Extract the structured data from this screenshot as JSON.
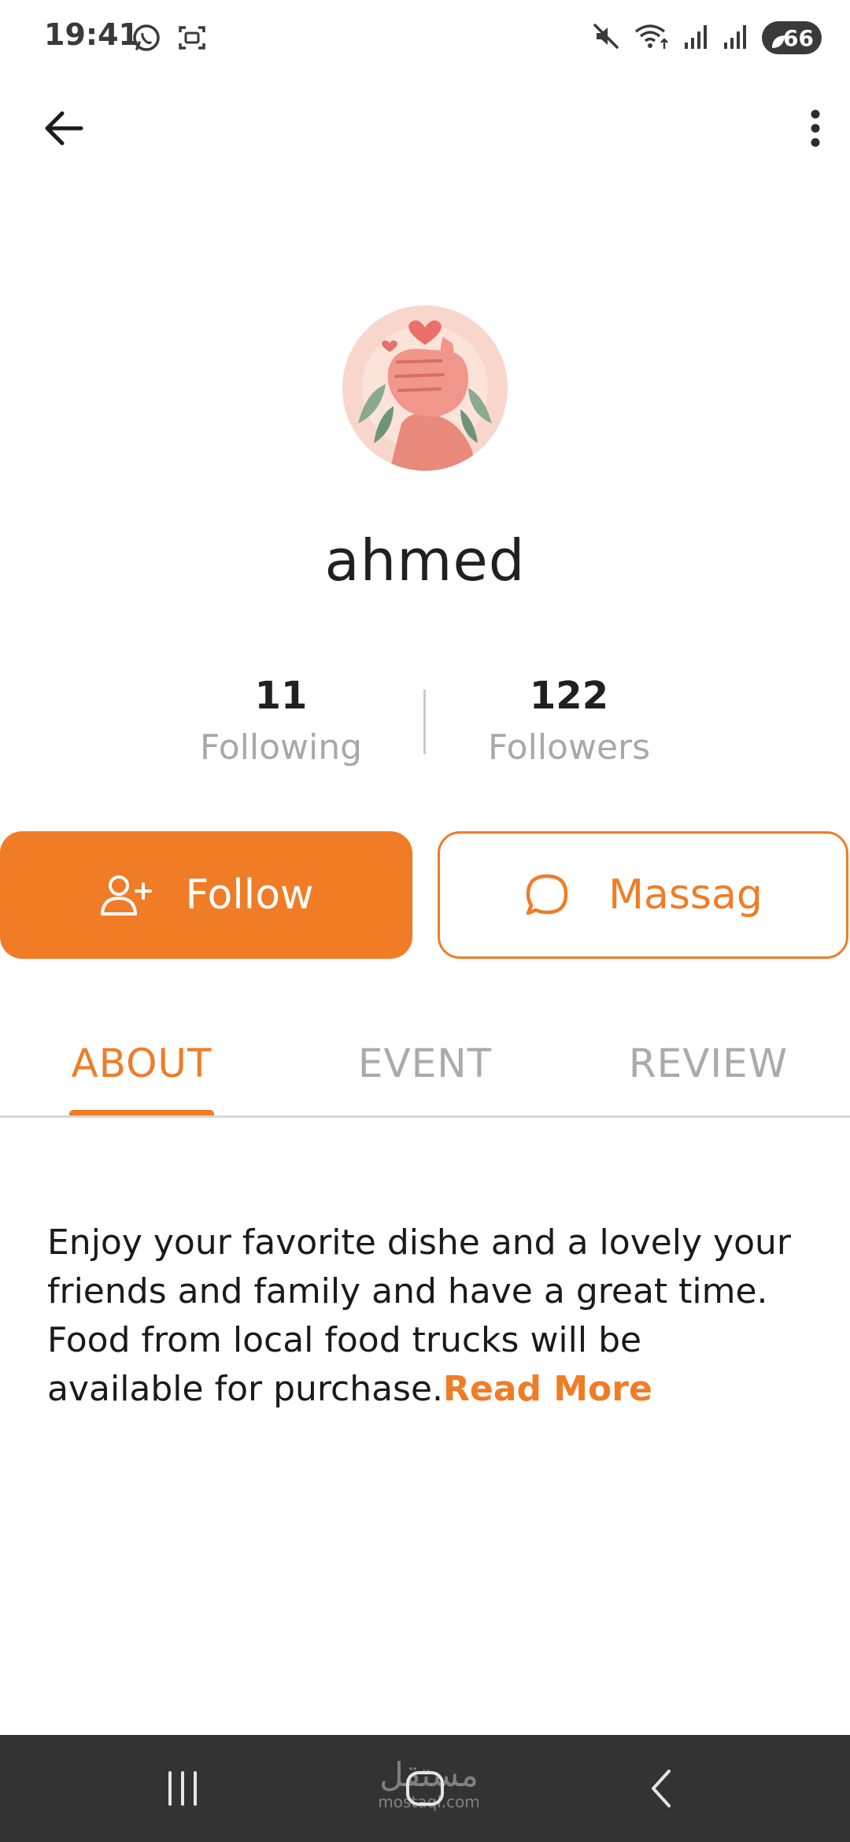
{
  "status_bar": {
    "time": "19:41",
    "battery_level": "66",
    "icons": [
      "whatsapp-icon",
      "screenshot-icon",
      "mute-icon",
      "wifi-icon",
      "signal-icon",
      "signal-icon"
    ]
  },
  "app_bar": {
    "back_icon": "arrow-left-icon",
    "menu_icon": "more-vertical-icon"
  },
  "profile": {
    "name": "ahmed",
    "avatar": "hands-heart-illustration"
  },
  "stats": {
    "following_count": "11",
    "following_label": "Following",
    "followers_count": "122",
    "followers_label": "Followers"
  },
  "actions": {
    "follow_label": "Follow",
    "follow_icon": "user-plus-icon",
    "message_label": "Massag",
    "message_icon": "chat-bubble-icon"
  },
  "tabs": [
    {
      "label": "ABOUT",
      "active": true
    },
    {
      "label": "EVENT",
      "active": false
    },
    {
      "label": "REVIEW",
      "active": false
    }
  ],
  "about": {
    "text": "Enjoy your favorite dishe and a lovely your friends and family and have a great time. Food from local food trucks will be available for purchase.",
    "read_more": "Read More"
  },
  "watermark": {
    "arabic": "مستقل",
    "latin": "mostaql.com"
  },
  "colors": {
    "accent": "#f07c26",
    "muted_text": "#a9a9ae",
    "nav_bar": "#333333"
  }
}
